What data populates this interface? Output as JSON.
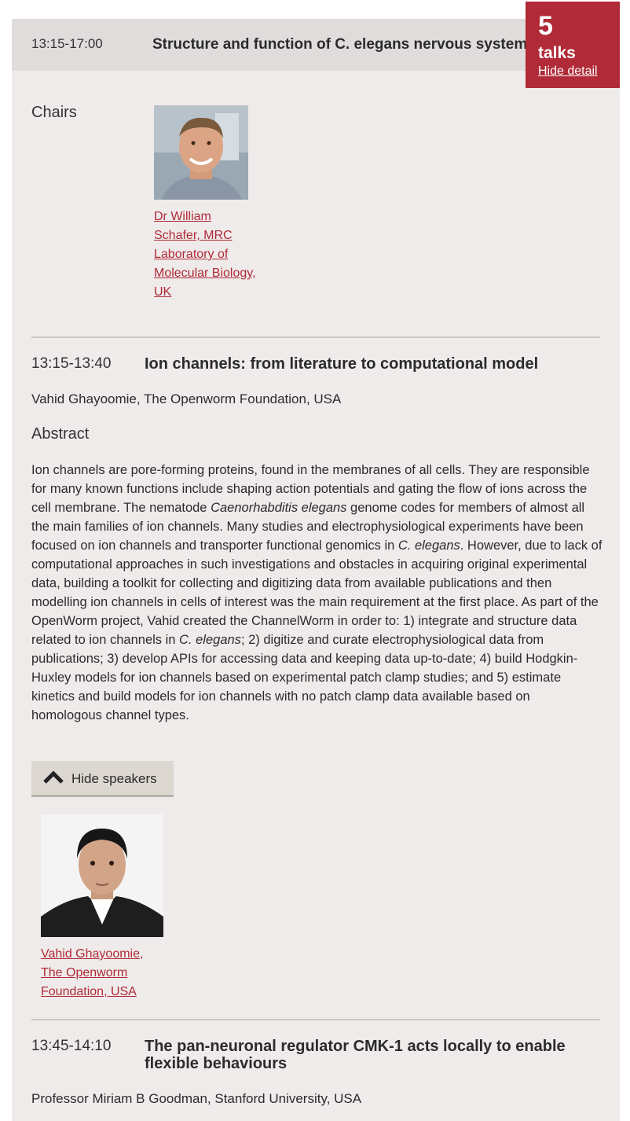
{
  "session": {
    "time": "13:15-17:00",
    "title": "Structure and function of C. elegans nervous system",
    "talk_count": "5",
    "talks_word": "talks",
    "hide_detail": "Hide detail"
  },
  "chairs": {
    "label": "Chairs",
    "person": "Dr William Schafer, MRC Laboratory of Molecular Biology, UK"
  },
  "talks": [
    {
      "time": "13:15-13:40",
      "title": "Ion channels: from literature to computational model",
      "speaker": "Vahid Ghayoomie, The Openworm Foundation, USA",
      "abstract_heading": "Abstract",
      "abstract": {
        "p1": "Ion channels are pore-forming proteins, found in the membranes of all cells. They are responsible for many known functions include shaping action potentials and gating the flow of ions across the cell membrane. The nematode ",
        "i1": "Caenorhabditis elegans",
        "p2": " genome codes for members of almost all the main families of ion channels. Many studies and electrophysiological experiments have been focused on ion channels and transporter functional genomics in ",
        "i2": "C. elegans",
        "p3": ". However, due to lack of computational approaches in such investigations and obstacles in acquiring original experimental data, building a toolkit for collecting and digitizing data from available publications and then modelling ion channels in cells of interest was the main requirement at the first place. As part of the OpenWorm project, Vahid created the ChannelWorm in order to: 1) integrate and structure data related to ion channels in ",
        "i3": "C. elegans",
        "p4": "; 2) digitize and curate electrophysiological data from publications; 3) develop APIs for accessing data and keeping data up-to-date; 4) build Hodgkin-Huxley models for ion channels based on experimental patch clamp studies; and 5) estimate kinetics and build models for ion channels with no patch clamp data available based on homologous channel types."
      },
      "hide_speakers": "Hide speakers",
      "speaker_link": "Vahid Ghayoomie, The Openworm Foundation, USA"
    },
    {
      "time": "13:45-14:10",
      "title": "The pan-neuronal regulator CMK-1 acts locally to enable flexible behaviours",
      "speaker": "Professor Miriam B Goodman, Stanford University, USA"
    }
  ],
  "colors": {
    "accent": "#b02a37",
    "panel": "#efebea",
    "header": "#e0dcdb"
  },
  "icons": {
    "hide_speakers": "chevron-up-icon"
  }
}
